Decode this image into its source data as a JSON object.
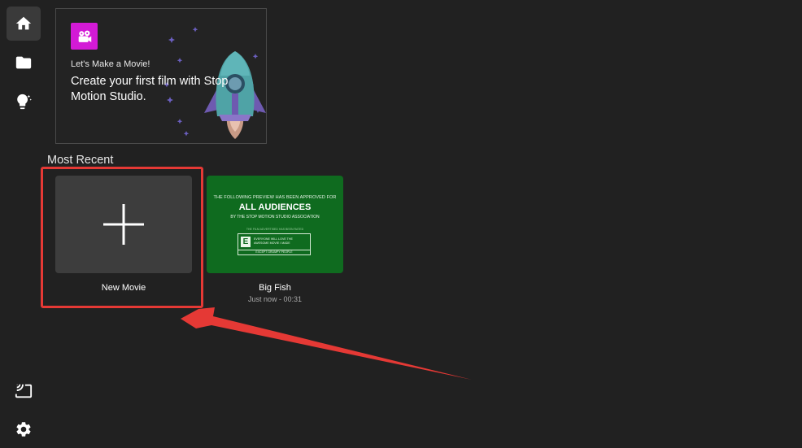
{
  "sidebar": {
    "items": [
      {
        "name": "Home",
        "icon": "home-icon",
        "active": true
      },
      {
        "name": "Projects",
        "icon": "folder-icon",
        "active": false
      },
      {
        "name": "Tips",
        "icon": "lightbulb-icon",
        "active": false
      }
    ],
    "bottom_items": [
      {
        "name": "Cast",
        "icon": "cast-icon"
      },
      {
        "name": "Settings",
        "icon": "gear-icon"
      }
    ]
  },
  "hero": {
    "logo_icon": "film-camera-icon",
    "logo_color": "#d31ad6",
    "subtitle": "Let's Make a Movie!",
    "title": "Create your first film with Stop Motion Studio."
  },
  "most_recent": {
    "title": "Most Recent",
    "new_movie": {
      "label": "New Movie",
      "icon": "plus-icon"
    },
    "movies": [
      {
        "title": "Big Fish",
        "meta": "Just now - 00:31",
        "thumb": {
          "line1": "THE FOLLOWING PREVIEW HAS BEEN APPROVED FOR",
          "main": "ALL AUDIENCES",
          "line2": "BY THE STOP MOTION STUDIO ASSOCIATION",
          "line3": "THE FILM ADVERTISED HAS BEEN RATED",
          "rating": "E",
          "rating_desc": "EVERYONE WILL LOVE THE AWESOME MOVIE I MADE",
          "rating_foot": "EXCEPT GRUMPY PEOPLE",
          "bg_color": "#0f6b1f"
        }
      }
    ]
  },
  "annotation": {
    "color": "#e53935"
  }
}
